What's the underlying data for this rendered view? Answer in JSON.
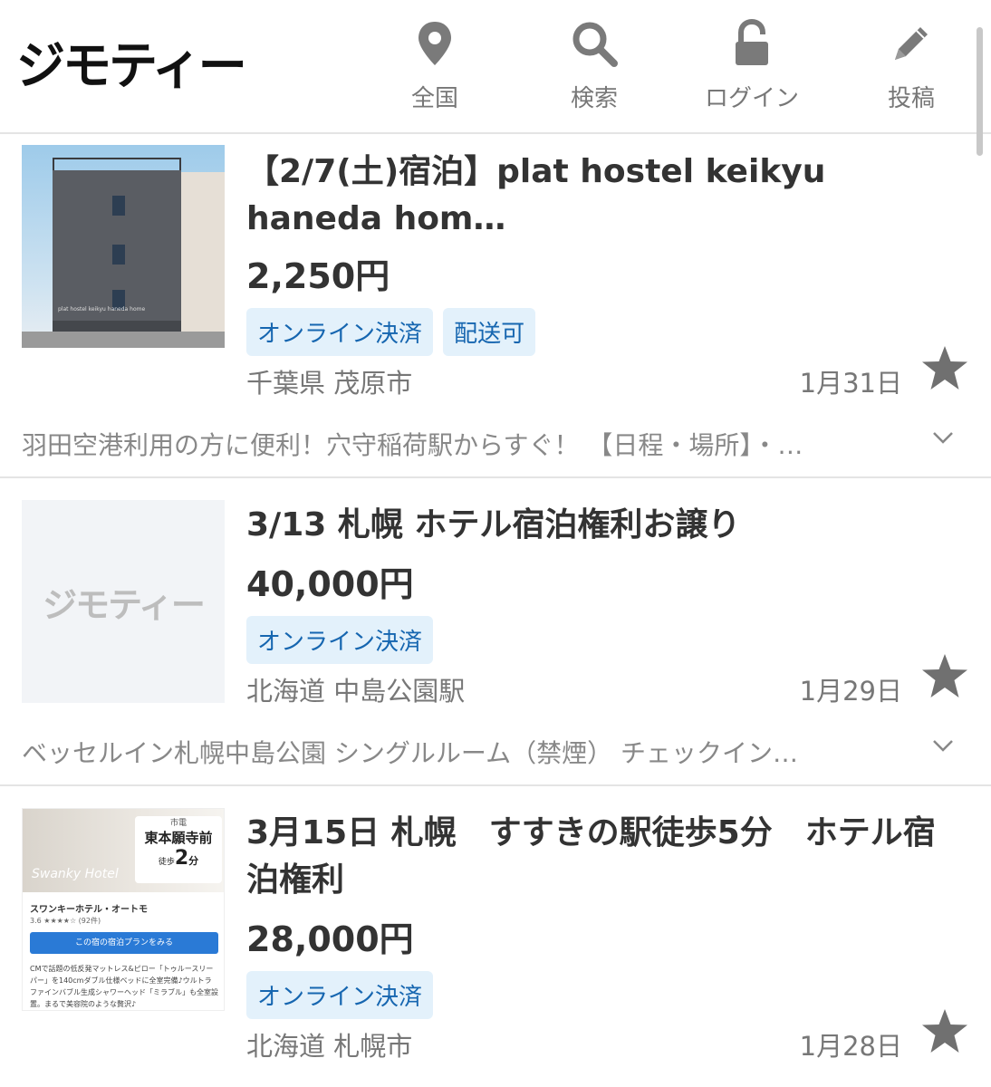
{
  "header": {
    "logo": "ジモティー",
    "nav": [
      {
        "label": "全国",
        "icon": "location-pin-icon"
      },
      {
        "label": "検索",
        "icon": "search-icon"
      },
      {
        "label": "ログイン",
        "icon": "unlock-icon"
      },
      {
        "label": "投稿",
        "icon": "pencil-icon"
      }
    ]
  },
  "listings": [
    {
      "title": "【2/7(土)宿泊】plat hostel keikyu haneda hom…",
      "price": "2,250円",
      "tags": [
        "オンライン決済",
        "配送可"
      ],
      "location": "千葉県 茂原市",
      "date": "1月31日",
      "description": "羽田空港利用の方に便利！穴守稲荷駅からすぐ！ 【日程・場所】・…",
      "thumb_text": "plat hostel keikyu haneda home"
    },
    {
      "title": "3/13 札幌 ホテル宿泊権利お譲り",
      "price": "40,000円",
      "tags": [
        "オンライン決済"
      ],
      "location": "北海道 中島公園駅",
      "date": "1月29日",
      "description": "ベッセルイン札幌中島公園 シングルルーム（禁煙） チェックイン…",
      "thumb_text": "ジモティー"
    },
    {
      "title": "3月15日 札幌　すすきの駅徒歩5分　ホテル宿泊権利",
      "price": "28,000円",
      "tags": [
        "オンライン決済"
      ],
      "location": "北海道 札幌市",
      "date": "1月28日",
      "thumb": {
        "station_label": "市電",
        "station": "東本願寺前",
        "walk_prefix": "徒歩",
        "walk_minutes": "2",
        "walk_unit": "分",
        "brand": "Swanky Hotel",
        "hotel_name": "スワンキーホテル・オートモ",
        "rating": "3.6 ★★★★☆ (92件)",
        "button": "この宿の宿泊プランをみる",
        "text": "CMで話題の低反発マットレス&ピロー「トゥルースリーパー」を140cmダブル仕様ベッドに全室完備♪ウルトラファインバブル生成シャワーヘッド「ミラブル」も全室設置。まるで美容院のような贅沢♪"
      }
    }
  ],
  "colors": {
    "tag_bg": "#e3f1fb",
    "tag_text": "#1666b0",
    "star": "#707070",
    "divider": "#e4e4e4"
  }
}
